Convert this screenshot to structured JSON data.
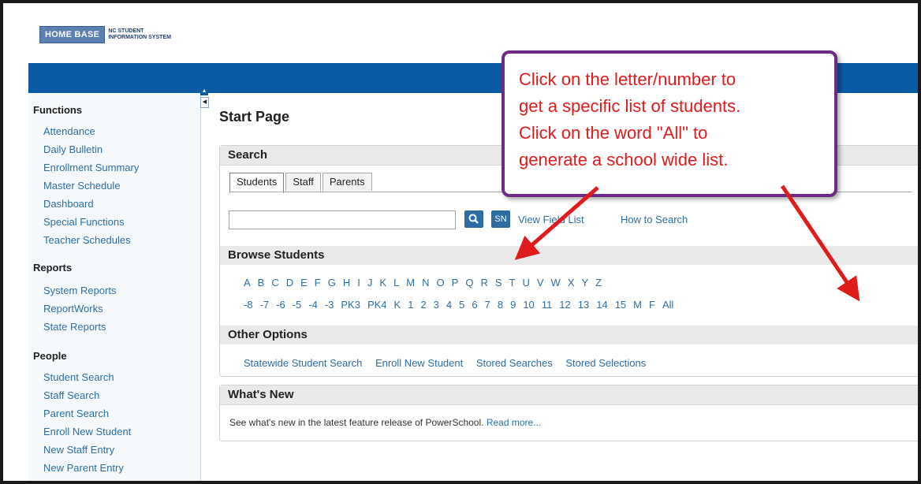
{
  "header": {
    "logo_text": "HOME BASE",
    "logo_subtitle_line1": "NC STUDENT",
    "logo_subtitle_line2": "INFORMATION SYSTEM"
  },
  "sidebar": {
    "sections": [
      {
        "title": "Functions",
        "items": [
          "Attendance",
          "Daily Bulletin",
          "Enrollment Summary",
          "Master Schedule",
          "Dashboard",
          "Special Functions",
          "Teacher Schedules"
        ]
      },
      {
        "title": "Reports",
        "items": [
          "System Reports",
          "ReportWorks",
          "State Reports"
        ]
      },
      {
        "title": "People",
        "items": [
          "Student Search",
          "Staff Search",
          "Parent Search",
          "Enroll New Student",
          "New Staff Entry",
          "New Parent Entry"
        ]
      }
    ]
  },
  "main": {
    "page_title": "Start Page",
    "search": {
      "heading": "Search",
      "tabs": [
        "Students",
        "Staff",
        "Parents"
      ],
      "input_value": "",
      "sn_label": "SN",
      "view_field_list": "View Field List",
      "how_to_search": "How to Search"
    },
    "browse": {
      "heading": "Browse Students",
      "letters": [
        "A",
        "B",
        "C",
        "D",
        "E",
        "F",
        "G",
        "H",
        "I",
        "J",
        "K",
        "L",
        "M",
        "N",
        "O",
        "P",
        "Q",
        "R",
        "S",
        "T",
        "U",
        "V",
        "W",
        "X",
        "Y",
        "Z"
      ],
      "grades": [
        "-8",
        "-7",
        "-6",
        "-5",
        "-4",
        "-3",
        "PK3",
        "PK4",
        "K",
        "1",
        "2",
        "3",
        "4",
        "5",
        "6",
        "7",
        "8",
        "9",
        "10",
        "11",
        "12",
        "13",
        "14",
        "15",
        "M",
        "F",
        "All"
      ]
    },
    "other_options": {
      "heading": "Other Options",
      "links": [
        "Statewide Student Search",
        "Enroll New Student",
        "Stored Searches",
        "Stored Selections"
      ]
    },
    "whats_new": {
      "heading": "What's New",
      "text": "See what's new in the latest feature release of PowerSchool.",
      "link": "Read more..."
    }
  },
  "callout": {
    "text": "Click on the letter/number to\nget a specific list of students.\nClick on the word \"All\" to\ngenerate a school wide list."
  },
  "colors": {
    "brand_blue": "#0a5aa6",
    "link_blue": "#2e6da4",
    "callout_border": "#6e2a84",
    "callout_text": "#e01b1b",
    "arrow_red": "#e01b1b"
  }
}
